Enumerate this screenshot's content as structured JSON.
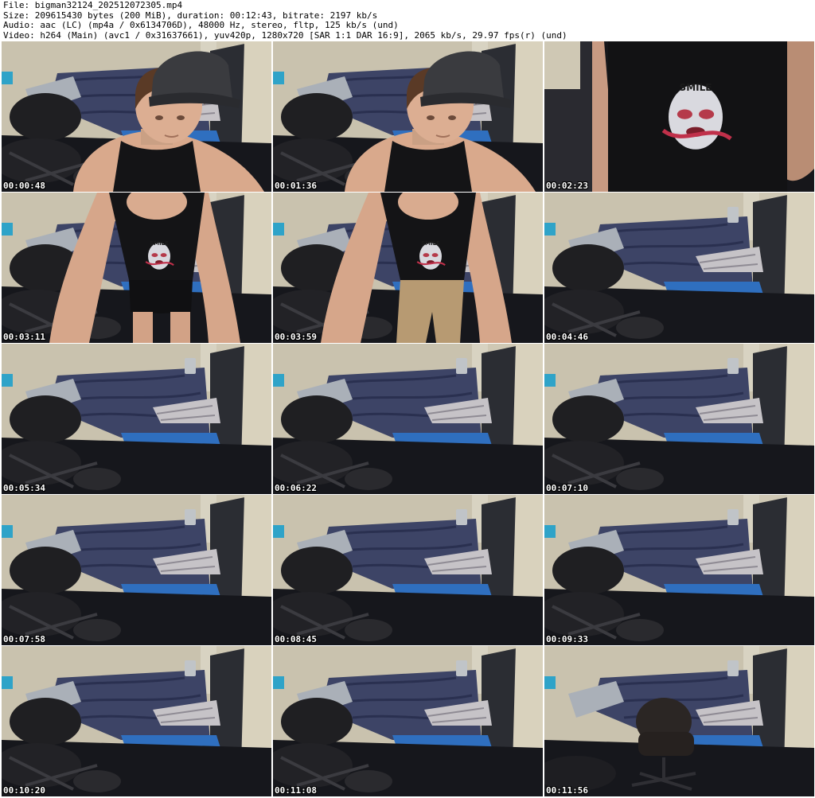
{
  "header": {
    "file": "File: bigman32124_202512072305.mp4",
    "size": "Size: 209615430 bytes (200 MiB), duration: 00:12:43, bitrate: 2197 kb/s",
    "audio": "Audio: aac (LC) (mp4a / 0x6134706D), 48000 Hz, stereo, fltp, 125 kb/s (und)",
    "video": "Video: h264 (Main) (avc1 / 0x31637661), yuv420p, 1280x720 [SAR 1:1 DAR 16:9], 2065 kb/s, 29.97 fps(r) (und)"
  },
  "thumbnails": [
    {
      "timestamp": "00:00:48",
      "scene": "person-cap-closeup"
    },
    {
      "timestamp": "00:01:36",
      "scene": "person-cap-closeup"
    },
    {
      "timestamp": "00:02:23",
      "scene": "shirt-print-closeup",
      "print_text": "SMILE"
    },
    {
      "timestamp": "00:03:11",
      "scene": "person-leaning-shorts",
      "print_text": "SMILE"
    },
    {
      "timestamp": "00:03:59",
      "scene": "person-leaning-pants",
      "print_text": "SMILE"
    },
    {
      "timestamp": "00:04:46",
      "scene": "empty-room"
    },
    {
      "timestamp": "00:05:34",
      "scene": "empty-room"
    },
    {
      "timestamp": "00:06:22",
      "scene": "empty-room"
    },
    {
      "timestamp": "00:07:10",
      "scene": "empty-room"
    },
    {
      "timestamp": "00:07:58",
      "scene": "empty-room"
    },
    {
      "timestamp": "00:08:45",
      "scene": "empty-room"
    },
    {
      "timestamp": "00:09:33",
      "scene": "empty-room"
    },
    {
      "timestamp": "00:10:20",
      "scene": "empty-room"
    },
    {
      "timestamp": "00:11:08",
      "scene": "empty-room"
    },
    {
      "timestamp": "00:11:56",
      "scene": "empty-room-chair-center"
    }
  ]
}
